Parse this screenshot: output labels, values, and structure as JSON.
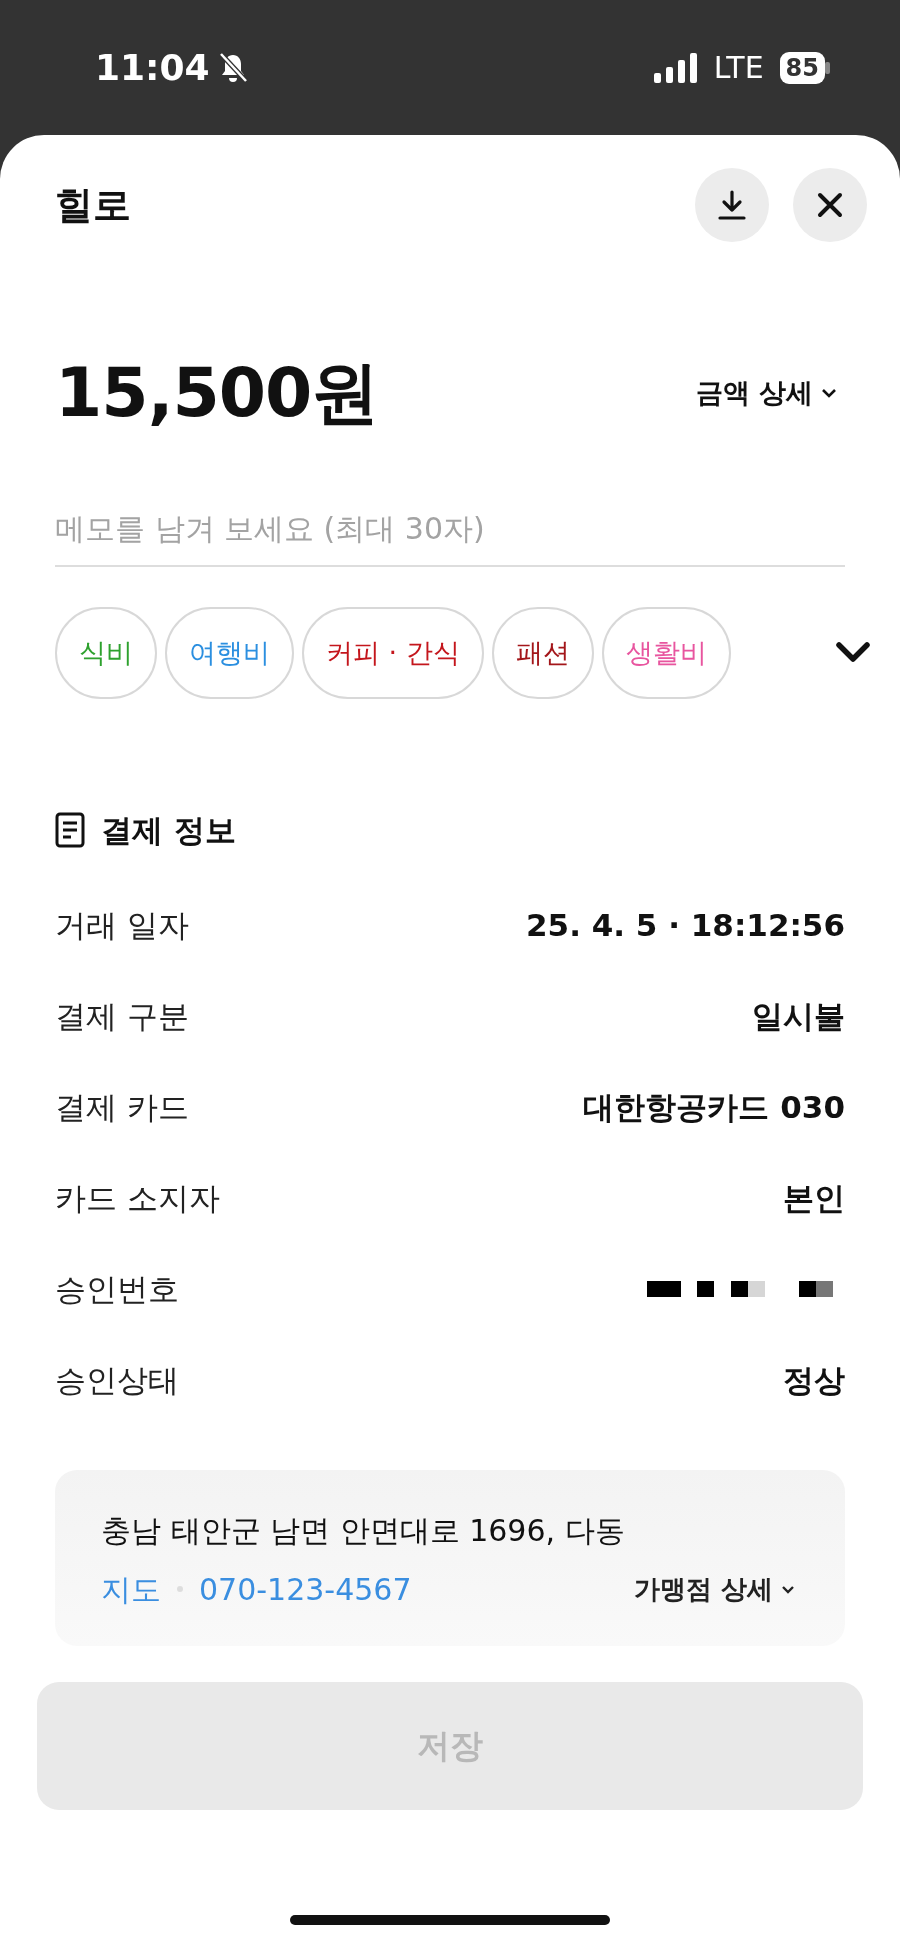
{
  "status_bar": {
    "time": "11:04",
    "network": "LTE",
    "battery": "85"
  },
  "header": {
    "title": "힐로"
  },
  "amount": {
    "value": "15,500원",
    "detail_link": "금액 상세"
  },
  "memo": {
    "placeholder": "메모를 남겨 보세요 (최대 30자)"
  },
  "categories": [
    {
      "label": "식비",
      "color": "#2ea12e"
    },
    {
      "label": "여행비",
      "color": "#2b8fe0"
    },
    {
      "label": "커피 · 간식",
      "color": "#c4161c"
    },
    {
      "label": "패션",
      "color": "#a3161a"
    },
    {
      "label": "생활비",
      "color": "#e8559f"
    }
  ],
  "payment_info": {
    "title": "결제 정보",
    "rows": [
      {
        "kind": "text",
        "label": "거래 일자",
        "value": "25. 4. 5 · 18:12:56"
      },
      {
        "kind": "text",
        "label": "결제 구분",
        "value": "일시불"
      },
      {
        "kind": "text",
        "label": "결제 카드",
        "value": "대한항공카드 030"
      },
      {
        "kind": "text",
        "label": "카드 소지자",
        "value": "본인"
      },
      {
        "kind": "redacted",
        "label": "승인번호"
      },
      {
        "kind": "text",
        "label": "승인상태",
        "value": "정상"
      }
    ]
  },
  "merchant": {
    "address": "충남 태안군 남면 안면대로 1696, 다동",
    "map_link": "지도",
    "phone": "070-123-4567",
    "detail_link": "가맹점 상세"
  },
  "save_button": {
    "label": "저장",
    "disabled": true
  }
}
